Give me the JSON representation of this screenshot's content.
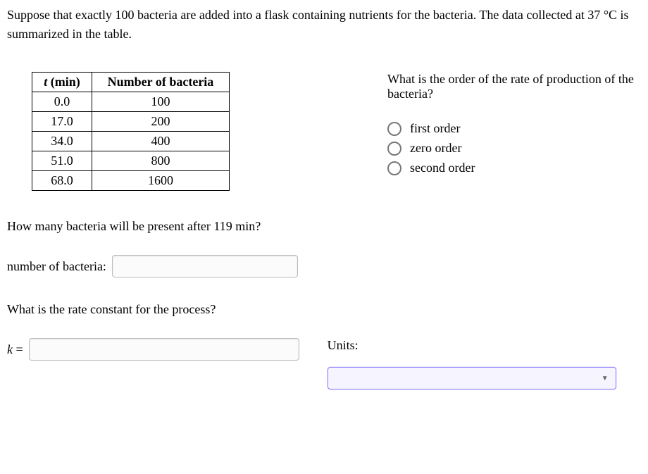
{
  "intro": "Suppose that exactly 100 bacteria are added into a flask containing nutrients for the bacteria. The data collected at 37 °C is summarized in the table.",
  "table": {
    "headers": {
      "col1_italic": "t",
      "col1_rest": " (min)",
      "col2": "Number of bacteria"
    },
    "rows": [
      {
        "t": "0.0",
        "n": "100"
      },
      {
        "t": "17.0",
        "n": "200"
      },
      {
        "t": "34.0",
        "n": "400"
      },
      {
        "t": "51.0",
        "n": "800"
      },
      {
        "t": "68.0",
        "n": "1600"
      }
    ]
  },
  "q_order": "What is the order of the rate of production of the bacteria?",
  "options": {
    "first": "first order",
    "zero": "zero order",
    "second": "second order"
  },
  "q_count": "How many bacteria will be present after 119 min?",
  "label_count": "number of bacteria:",
  "q_rate": "What is the rate constant for the process?",
  "label_k_italic": "k",
  "label_k_rest": " =",
  "units_label": "Units:"
}
